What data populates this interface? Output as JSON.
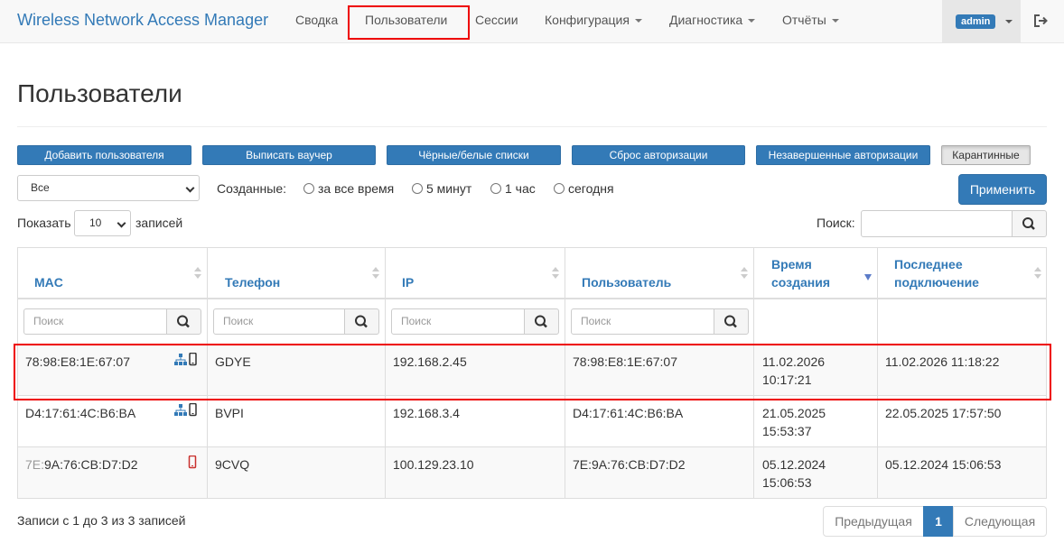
{
  "navbar": {
    "brand": "Wireless Network Access Manager",
    "items": [
      {
        "label": "Сводка"
      },
      {
        "label": "Пользователи"
      },
      {
        "label": "Сессии"
      },
      {
        "label": "Конфигурация"
      },
      {
        "label": "Диагностика"
      },
      {
        "label": "Отчёты"
      }
    ],
    "user": "admin"
  },
  "page": {
    "title": "Пользователи"
  },
  "toolbar": {
    "add_user": "Добавить пользователя",
    "voucher": "Выписать ваучер",
    "lists": "Чёрные/белые списки",
    "reset_auth": "Сброс авторизации",
    "pending_auth": "Незавершенные авторизации",
    "quarantine": "Карантинные"
  },
  "filters": {
    "type_selected": "Все",
    "created_label": "Созданные:",
    "options": [
      "за все время",
      "5 минут",
      "1 час",
      "сегодня"
    ],
    "apply": "Применить"
  },
  "length": {
    "show": "Показать",
    "value": "10",
    "entries": "записей"
  },
  "search": {
    "label": "Поиск:"
  },
  "table": {
    "columns": [
      {
        "label": "MAC"
      },
      {
        "label": "Телефон"
      },
      {
        "label": "IP"
      },
      {
        "label": "Пользователь"
      },
      {
        "label_line1": "Время",
        "label_line2": "создания"
      },
      {
        "label_line1": "Последнее",
        "label_line2": "подключение"
      }
    ],
    "search_placeholder": "Поиск",
    "rows": [
      {
        "mac": "78:98:E8:1E:67:07",
        "phone": "GDYE",
        "ip": "192.168.2.45",
        "user": "78:98:E8:1E:67:07",
        "created_date": "11.02.2026",
        "created_time": "10:17:21",
        "last": "11.02.2026 11:18:22"
      },
      {
        "mac": "D4:17:61:4C:B6:BA",
        "phone": "BVPI",
        "ip": "192.168.3.4",
        "user": "D4:17:61:4C:B6:BA",
        "created_date": "21.05.2025",
        "created_time": "15:53:37",
        "last": "22.05.2025 17:57:50"
      },
      {
        "mac_prefix": "7E:",
        "mac_rest": "9A:76:CB:D7:D2",
        "phone": "9CVQ",
        "ip": "100.129.23.10",
        "user": "7E:9A:76:CB:D7:D2",
        "created_date": "05.12.2024",
        "created_time": "15:06:53",
        "last": "05.12.2024 15:06:53"
      }
    ]
  },
  "footer": {
    "info": "Записи с 1 до 3 из 3 записей",
    "prev": "Предыдущая",
    "page": "1",
    "next": "Следующая"
  },
  "colors": {
    "primary": "#337ab7",
    "highlight": "#ee0000",
    "device_red": "#c9302c"
  }
}
